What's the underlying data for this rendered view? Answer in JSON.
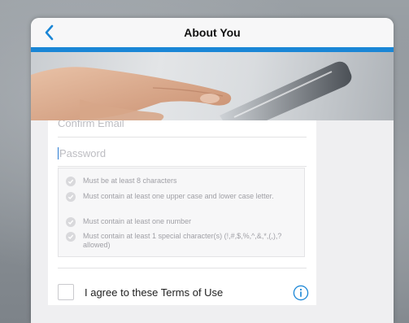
{
  "header": {
    "title": "About You",
    "back_icon": "chevron-left-icon"
  },
  "form": {
    "confirm_email_placeholder": "Confirm Email",
    "password_placeholder": "Password",
    "password_rules": [
      "Must be at least 8 characters",
      "Must contain at least one upper case and lower case letter.",
      "Must contain at least one number",
      "Must contain at least 1 special character(s) (!,#,$,%,^,&,*,(,),? allowed)"
    ],
    "terms_label": "I agree to these Terms of Use",
    "terms_checked": false,
    "info_icon": "info-icon"
  },
  "colors": {
    "accent": "#1a86d6",
    "rule_check": "#d9d9dc",
    "modal_bg": "#efeff1"
  }
}
